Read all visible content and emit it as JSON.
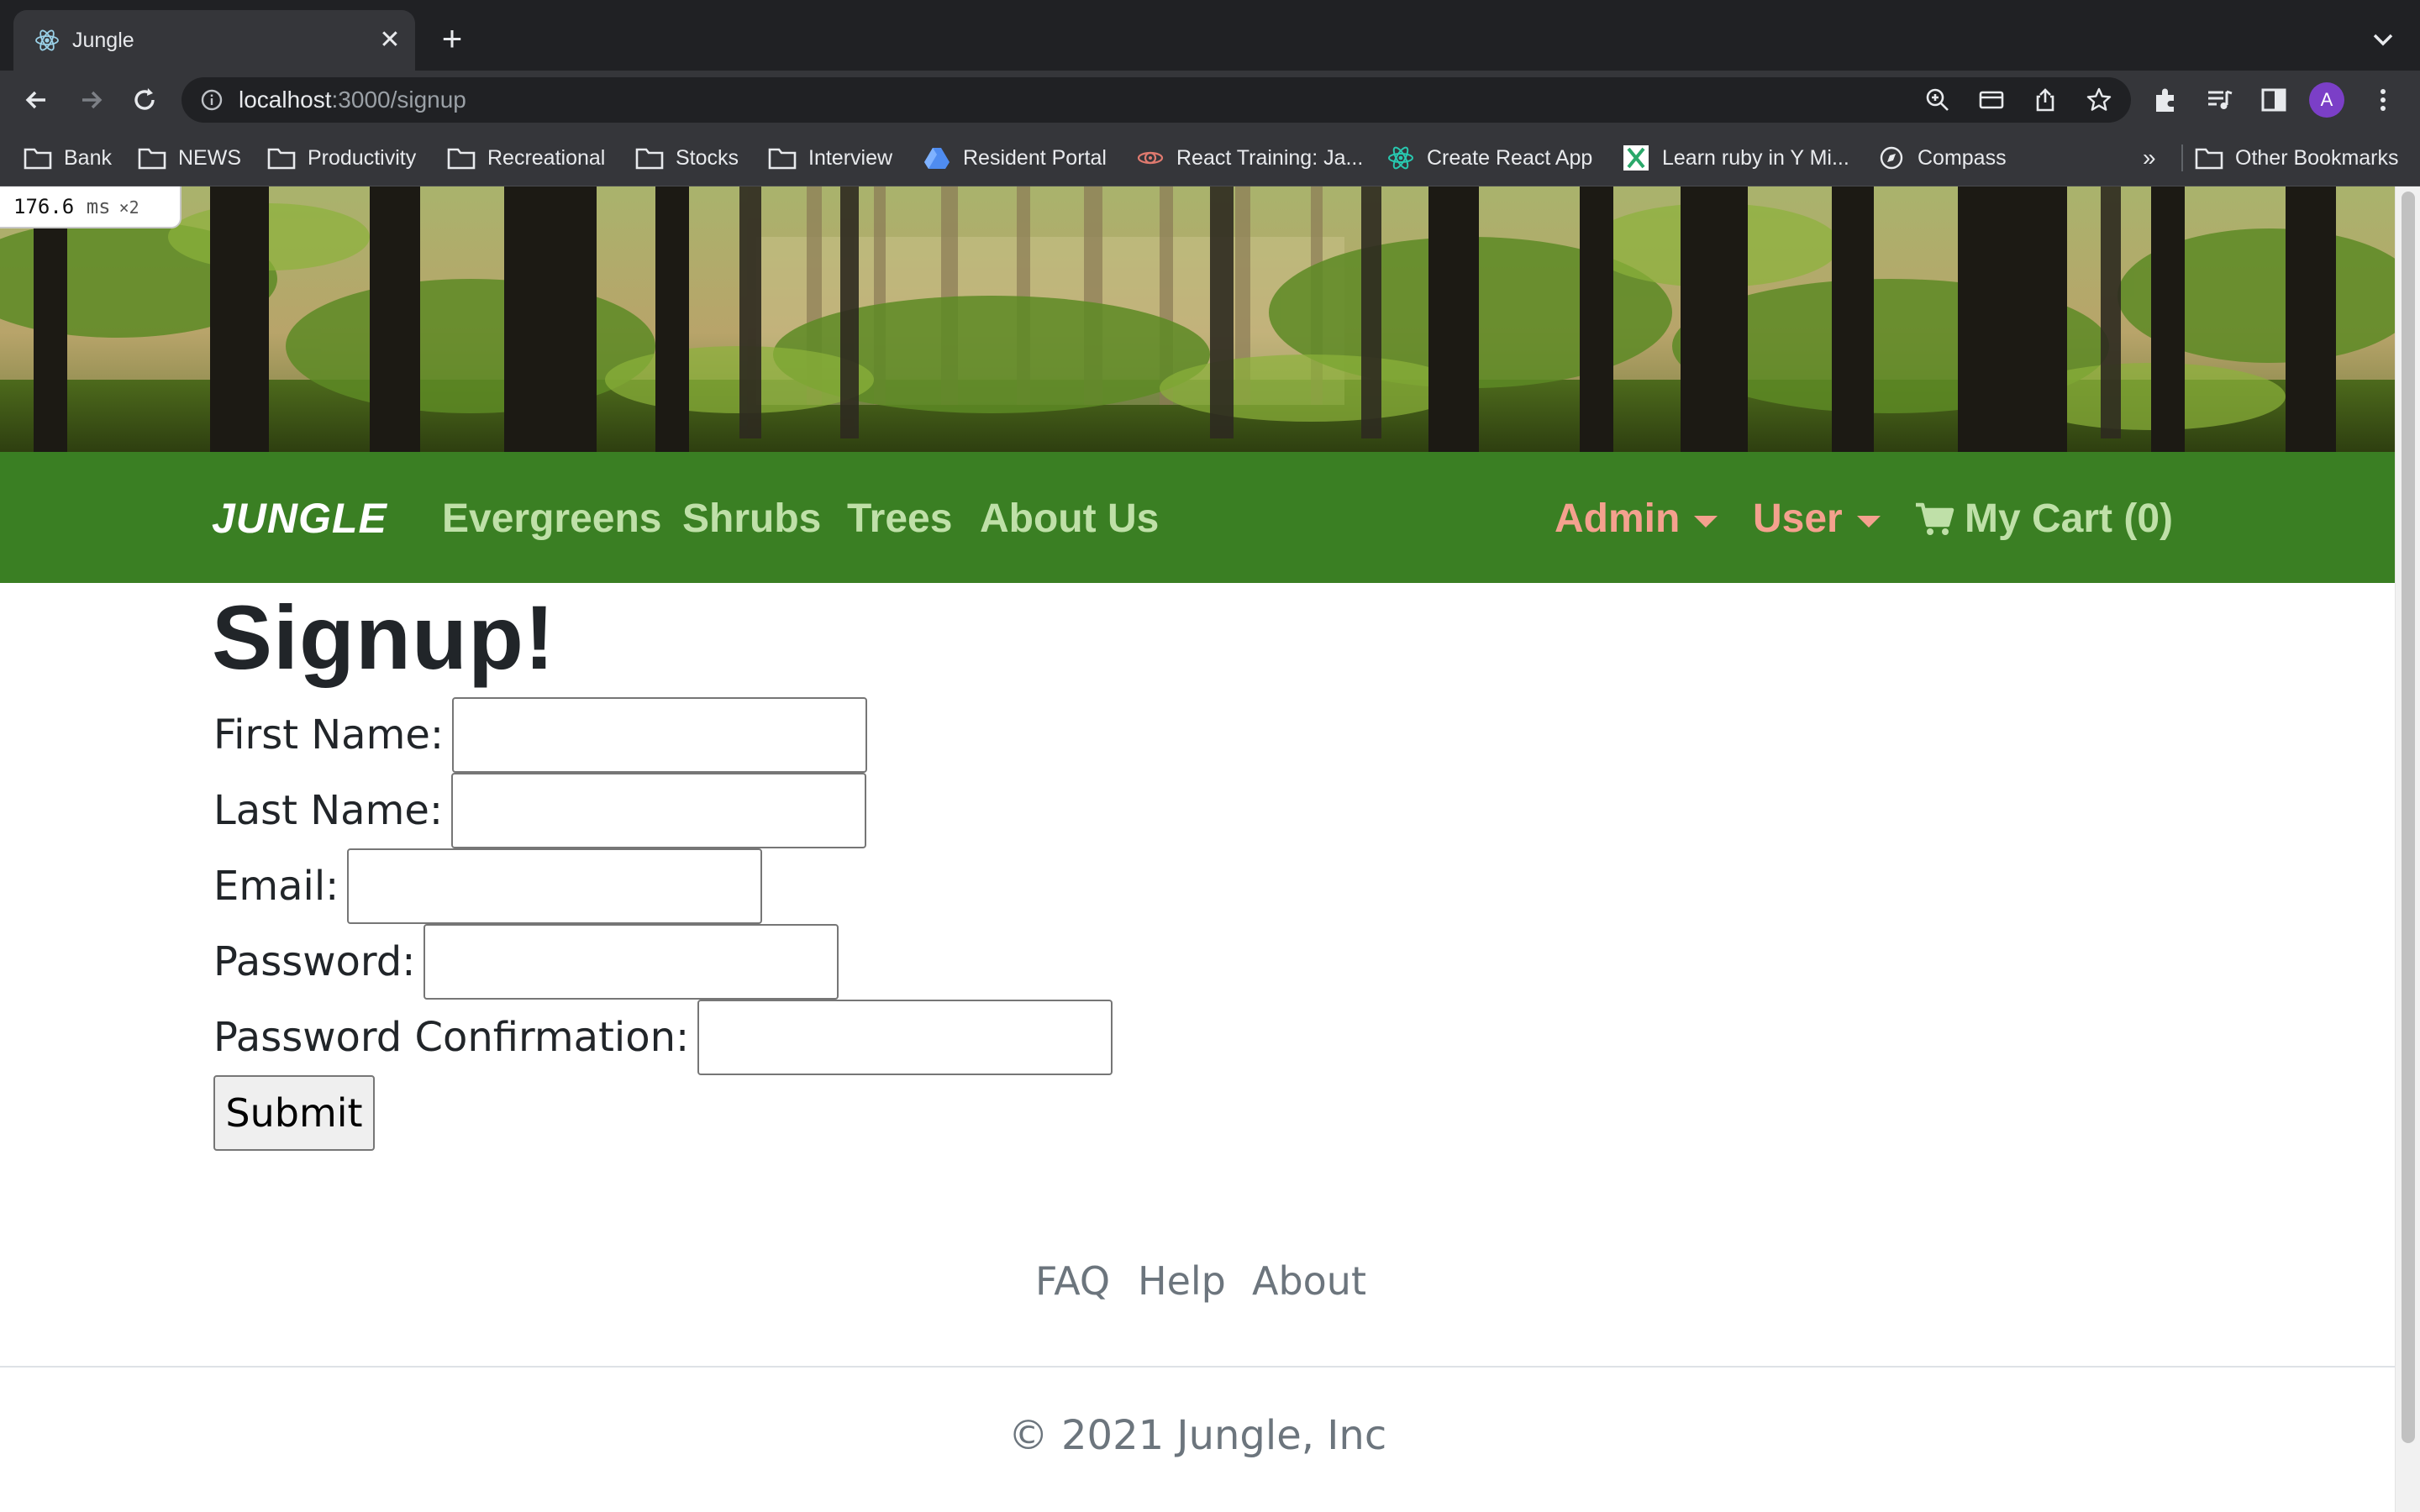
{
  "browser": {
    "tab_title": "Jungle",
    "url_host": "localhost",
    "url_path": ":3000/signup",
    "profile_initial": "A",
    "bookmarks": [
      {
        "label": "Bank",
        "icon": "folder-icon"
      },
      {
        "label": "NEWS",
        "icon": "folder-icon"
      },
      {
        "label": "Productivity",
        "icon": "folder-icon"
      },
      {
        "label": "Recreational",
        "icon": "folder-icon"
      },
      {
        "label": "Stocks",
        "icon": "folder-icon"
      },
      {
        "label": "Interview",
        "icon": "folder-icon"
      },
      {
        "label": "Resident Portal",
        "icon": "drive-icon"
      },
      {
        "label": "React Training: Ja...",
        "icon": "react-training-icon"
      },
      {
        "label": "Create React App",
        "icon": "react-icon"
      },
      {
        "label": "Learn ruby in Y Mi...",
        "icon": "x-site-icon"
      },
      {
        "label": "Compass",
        "icon": "compass-icon"
      }
    ],
    "bookmarks_overflow": "»",
    "other_bookmarks": "Other Bookmarks"
  },
  "perf": {
    "value": "176.6",
    "unit": "ms",
    "multiplier": "×2"
  },
  "navbar": {
    "brand": "JUNGLE",
    "links": [
      "Evergreens",
      "Shrubs",
      "Trees",
      "About Us"
    ],
    "admin": "Admin",
    "user": "User",
    "cart": "My Cart (0)"
  },
  "signup": {
    "title": "Signup!",
    "first_name_label": "First Name:",
    "last_name_label": "Last Name:",
    "email_label": "Email:",
    "password_label": "Password:",
    "password_confirmation_label": "Password Confirmation:",
    "submit": "Submit"
  },
  "footer": {
    "links": [
      "FAQ",
      "Help",
      "About"
    ],
    "copyright": "© 2021 Jungle, Inc"
  },
  "colors": {
    "navbar": "#3a7f23",
    "nav_link": "#bfe0a8",
    "dropdown": "#f4a18e",
    "chrome_dark": "#202124",
    "chrome_mid": "#35363a"
  }
}
